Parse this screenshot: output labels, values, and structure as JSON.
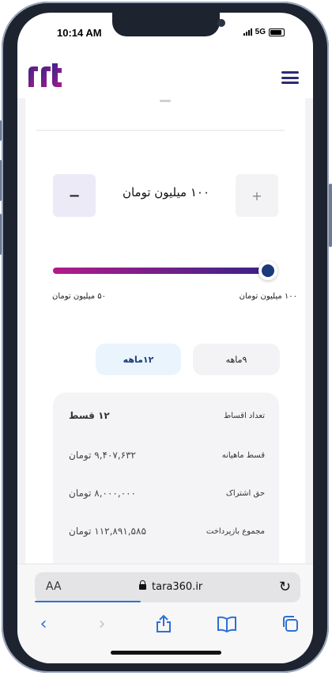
{
  "status": {
    "time": "10:14 AM",
    "network": "5G"
  },
  "header": {
    "logo_icon": "tara-logo-icon",
    "menu_icon": "hamburger-menu-icon"
  },
  "loan": {
    "amount": "۱۰۰ میلیون تومان",
    "minus_label": "−",
    "plus_label": "+",
    "slider_min_label": "۵۰ میلیون تومان",
    "slider_max_label": "۱۰۰ میلیون تومان",
    "slider_fraction": 1.0
  },
  "tabs": [
    {
      "label": "۱۲ماهه",
      "selected": true
    },
    {
      "label": "۹ماهه",
      "selected": false
    }
  ],
  "summary": [
    {
      "label": "تعداد اقساط",
      "value": "۱۲ قسط"
    },
    {
      "label": "قسط ماهیانه",
      "value": "۹,۴۰۷,۶۳۲ تومان"
    },
    {
      "label": "حق اشتراک",
      "value": "۸,۰۰۰,۰۰۰ تومان"
    },
    {
      "label": "مجموع بازپرداخت",
      "value": "۱۱۲,۸۹۱,۵۸۵ تومان"
    }
  ],
  "browser": {
    "text_size_label": "AA",
    "url": "tara360.ir"
  },
  "colors": {
    "brand_purple": "#3a2388",
    "brand_magenta": "#b11b8a",
    "thumb_navy": "#1b3a7a",
    "safari_blue": "#2f6fd6"
  }
}
